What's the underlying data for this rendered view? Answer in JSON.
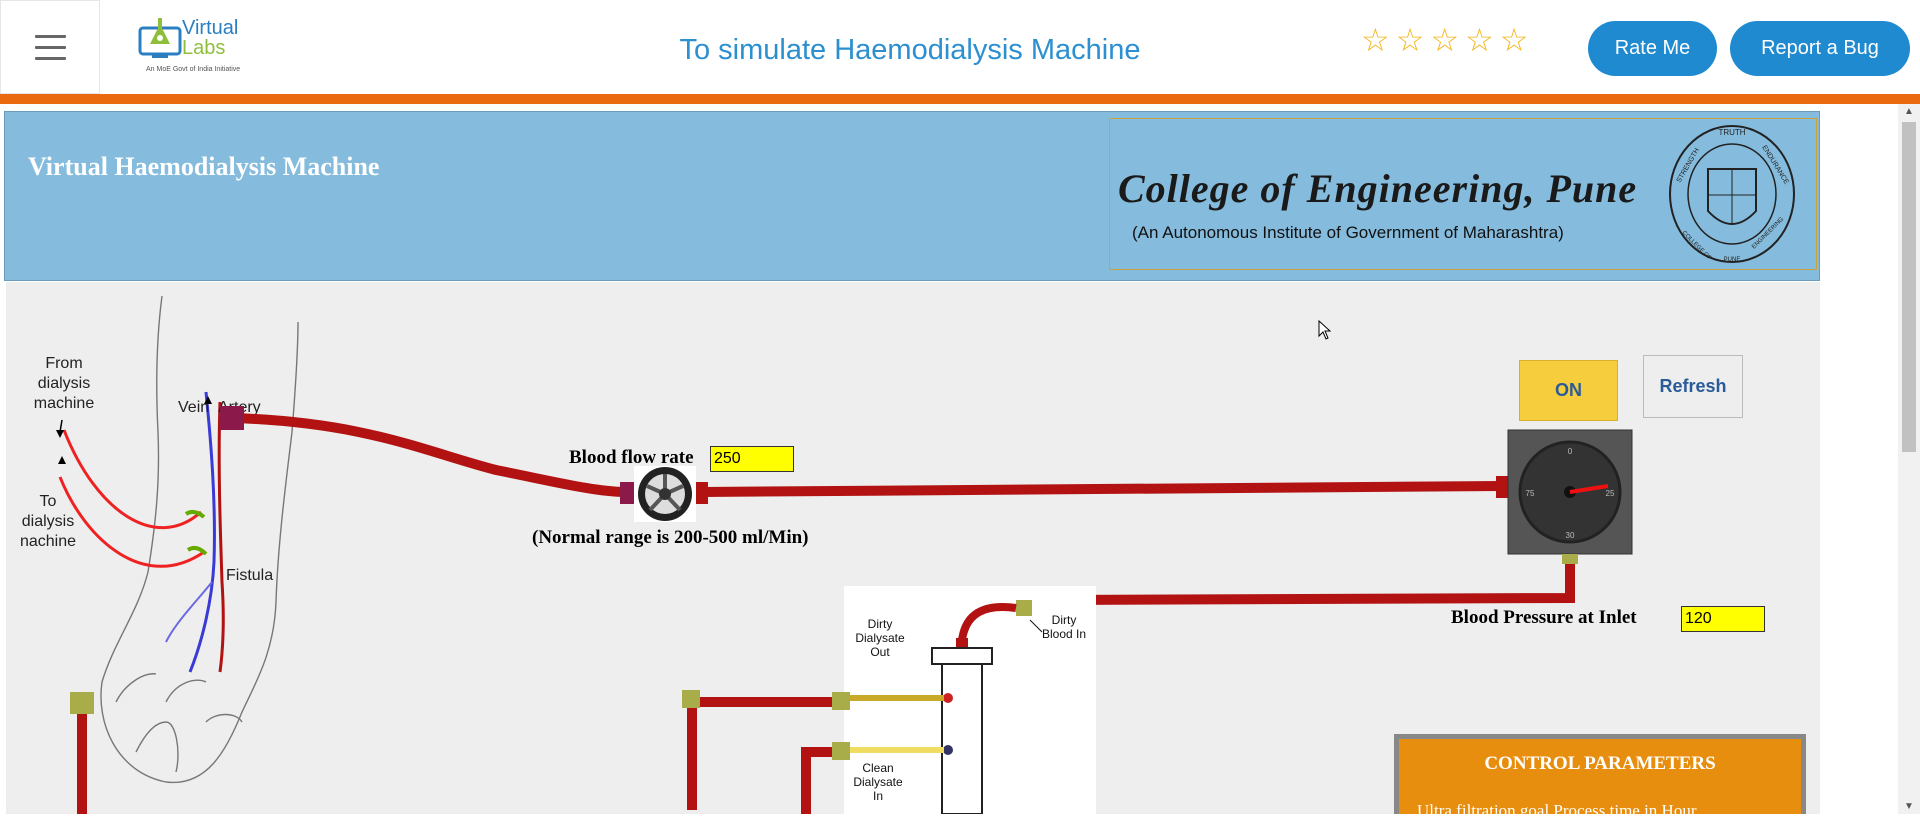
{
  "header": {
    "logo_line1": "Virtual",
    "logo_line2": "Labs",
    "logo_sub": "An MoE Govt of India Initiative",
    "title": "To simulate Haemodialysis Machine",
    "rating_stars": [
      "☆",
      "☆",
      "☆",
      "☆",
      "☆"
    ],
    "rate_label": "Rate Me",
    "bug_label": "Report a Bug"
  },
  "banner": {
    "title": "Virtual Haemodialysis Machine",
    "college_name": "College of Engineering, Pune",
    "college_sub": "(An Autonomous Institute of Government of Maharashtra)",
    "seal_top": "TRUTH",
    "seal_left": "STRENGTH",
    "seal_right": "ENDURANCE",
    "seal_bottom_left": "COLLEGE OF",
    "seal_bottom_right": "ENGINEERING",
    "seal_bottom": "PUNE"
  },
  "arm": {
    "from_label": [
      "From",
      "dialysis",
      "machine"
    ],
    "to_label": [
      "To",
      "dialysis",
      "nachine"
    ],
    "vein": "Vein",
    "artery": "Artery",
    "fistula": "Fistula"
  },
  "controls": {
    "on_label": "ON",
    "refresh_label": "Refresh",
    "blood_flow_label": "Blood flow rate",
    "blood_flow_value": "250",
    "normal_range": "(Normal range is 200-500 ml/Min)",
    "bp_label": "Blood Pressure at Inlet",
    "bp_value": "120",
    "gauge_ticks": [
      "0",
      "25",
      "30",
      "75"
    ]
  },
  "dialyzer": {
    "dirty_dialysate_out": [
      "Dirty",
      "Dialysate",
      "Out"
    ],
    "dirty_blood_in": [
      "Dirty",
      "Blood In"
    ],
    "clean_dialysate_in": [
      "Clean",
      "Dialysate",
      "In"
    ]
  },
  "control_params": {
    "title": "CONTROL PARAMETERS",
    "subtitle": "Ultra filtration goal    Process time in Hour"
  },
  "colors": {
    "tube": "#b31212",
    "connector": "#a8ad4a",
    "accent": "#ea6a10",
    "brand": "#1f8ad0"
  }
}
